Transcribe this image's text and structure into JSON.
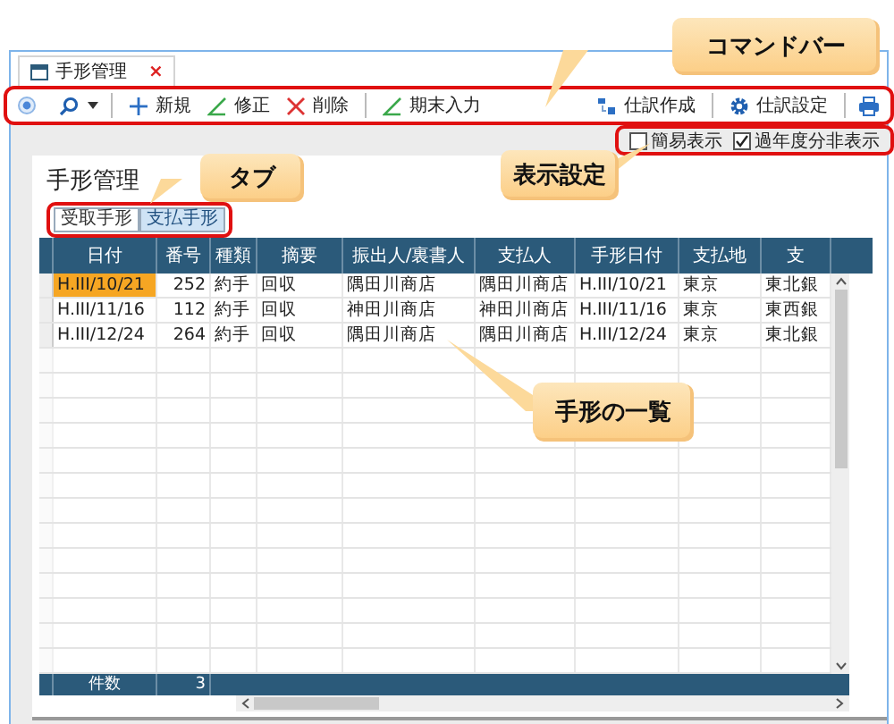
{
  "window_tab": {
    "title": "手形管理",
    "close": "×"
  },
  "toolbar": {
    "left_groups": [
      [
        {
          "label": "新規",
          "kind": "add"
        },
        {
          "label": "修正",
          "kind": "edit"
        },
        {
          "label": "削除",
          "kind": "delete"
        }
      ],
      [
        {
          "label": "期末入力",
          "kind": "edit"
        }
      ]
    ],
    "right_groups": [
      [
        {
          "label": "仕訳作成",
          "kind": "journal"
        }
      ],
      [
        {
          "label": "仕訳設定",
          "kind": "gear"
        }
      ]
    ]
  },
  "display_settings": [
    {
      "label": "簡易表示",
      "checked": false
    },
    {
      "label": "過年度分非表示",
      "checked": true
    }
  ],
  "page_title": "手形管理",
  "tabs": [
    {
      "label": "受取手形",
      "selected": true
    },
    {
      "label": "支払手形",
      "selected": false
    }
  ],
  "table": {
    "columns": [
      "日付",
      "番号",
      "種類",
      "摘要",
      "振出人/裏書人",
      "支払人",
      "手形日付",
      "支払地",
      "支"
    ],
    "rows": [
      {
        "selected": true,
        "cells": [
          "H.III/10/21",
          "252",
          "約手",
          "回収",
          "隅田川商店",
          "隅田川商店",
          "H.III/10/21",
          "東京",
          "東北銀"
        ]
      },
      {
        "selected": false,
        "cells": [
          "H.III/11/16",
          "112",
          "約手",
          "回収",
          "神田川商店",
          "神田川商店",
          "H.III/11/16",
          "東京",
          "東西銀"
        ]
      },
      {
        "selected": false,
        "cells": [
          "H.III/12/24",
          "264",
          "約手",
          "回収",
          "隅田川商店",
          "隅田川商店",
          "H.III/12/24",
          "東京",
          "東北銀"
        ]
      }
    ],
    "footer": {
      "label": "件数",
      "count": "3"
    }
  },
  "callouts": [
    {
      "text": "コマンドバー"
    },
    {
      "text": "タブ"
    },
    {
      "text": "表示設定"
    },
    {
      "text": "手形の一覧"
    }
  ]
}
